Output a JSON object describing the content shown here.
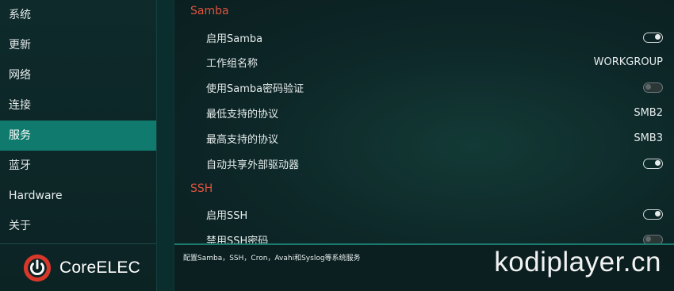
{
  "sidebar": {
    "items": [
      {
        "label": "系统"
      },
      {
        "label": "更新"
      },
      {
        "label": "网络"
      },
      {
        "label": "连接"
      },
      {
        "label": "服务",
        "active": true
      },
      {
        "label": "蓝牙"
      },
      {
        "label": "Hardware"
      },
      {
        "label": "关于"
      }
    ],
    "logo": {
      "part1": "Core",
      "part2": "ELEC"
    }
  },
  "main": {
    "sections": [
      {
        "title": "Samba",
        "rows": [
          {
            "label": "启用Samba",
            "toggle": "on"
          },
          {
            "label": "工作组名称",
            "value": "WORKGROUP"
          },
          {
            "label": "使用Samba密码验证",
            "toggle": "off"
          },
          {
            "label": "最低支持的协议",
            "value": "SMB2"
          },
          {
            "label": "最高支持的协议",
            "value": "SMB3"
          },
          {
            "label": "自动共享外部驱动器",
            "toggle": "on"
          }
        ]
      },
      {
        "title": "SSH",
        "rows": [
          {
            "label": "启用SSH",
            "toggle": "on"
          },
          {
            "label": "禁用SSH密码",
            "toggle": "off"
          }
        ]
      }
    ]
  },
  "footer": {
    "description": "配置Samba，SSH，Cron，Avahi和Syslog等系统服务",
    "watermark": "kodiplayer.cn"
  },
  "colors": {
    "accent": "#0f7a6d",
    "section_title": "#e0533c",
    "logo_red": "#d8382a"
  }
}
